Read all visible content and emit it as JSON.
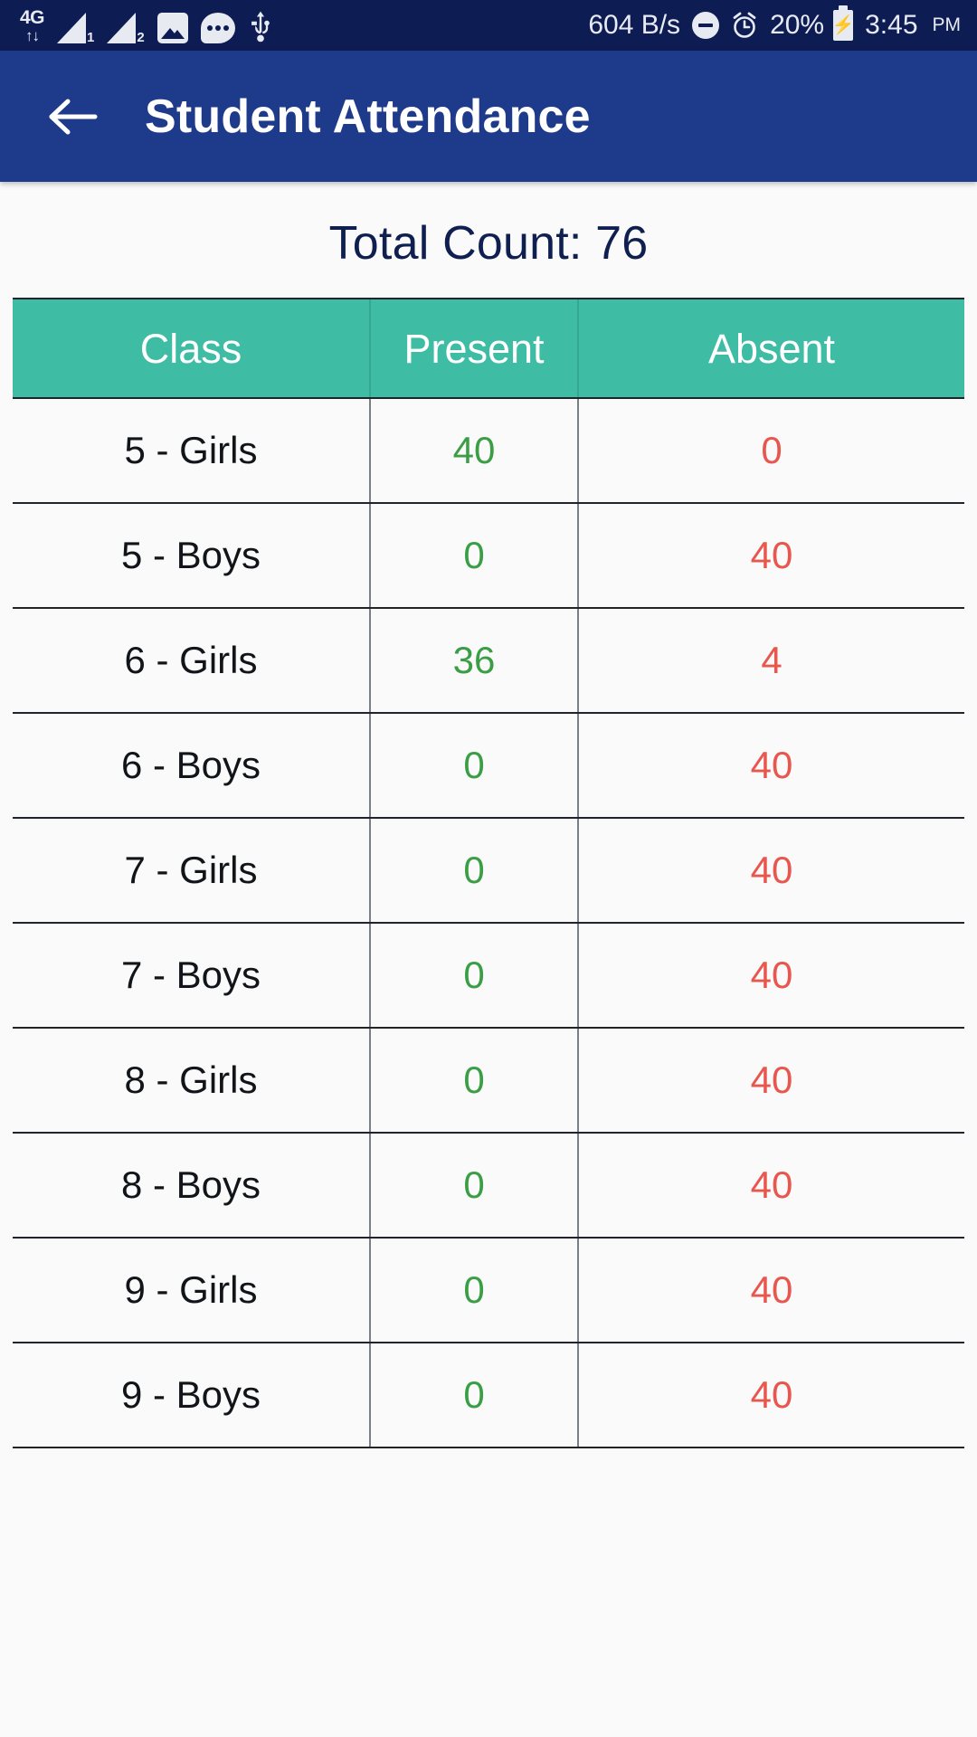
{
  "status_bar": {
    "network_type": "4G",
    "data_arrows": "↑↓",
    "sim1_label": "1",
    "sim2_label": "2",
    "icons": [
      "signal-sim1-icon",
      "signal-sim2-icon",
      "image-icon",
      "messaging-icon",
      "usb-icon",
      "do-not-disturb-icon",
      "alarm-icon",
      "battery-charging-icon"
    ],
    "net_speed": "604 B/s",
    "battery_percent": "20%",
    "time": "3:45",
    "am_pm": "PM",
    "background_color": "#0e1c54"
  },
  "app_bar": {
    "back_label": "back-arrow",
    "title": "Student Attendance",
    "background_color": "#1e3a8a",
    "text_color": "#ffffff"
  },
  "summary": {
    "total_count_label": "Total Count: 76"
  },
  "table": {
    "header_background": "#3fbca4",
    "present_color": "#3b9e45",
    "absent_color": "#e8564e",
    "columns": [
      "Class",
      "Present",
      "Absent"
    ],
    "rows": [
      {
        "class": "5 - Girls",
        "present": "40",
        "absent": "0"
      },
      {
        "class": "5 - Boys",
        "present": "0",
        "absent": "40"
      },
      {
        "class": "6 - Girls",
        "present": "36",
        "absent": "4"
      },
      {
        "class": "6 - Boys",
        "present": "0",
        "absent": "40"
      },
      {
        "class": "7 - Girls",
        "present": "0",
        "absent": "40"
      },
      {
        "class": "7 - Boys",
        "present": "0",
        "absent": "40"
      },
      {
        "class": "8 - Girls",
        "present": "0",
        "absent": "40"
      },
      {
        "class": "8 - Boys",
        "present": "0",
        "absent": "40"
      },
      {
        "class": "9 - Girls",
        "present": "0",
        "absent": "40"
      },
      {
        "class": "9 - Boys",
        "present": "0",
        "absent": "40"
      }
    ]
  }
}
